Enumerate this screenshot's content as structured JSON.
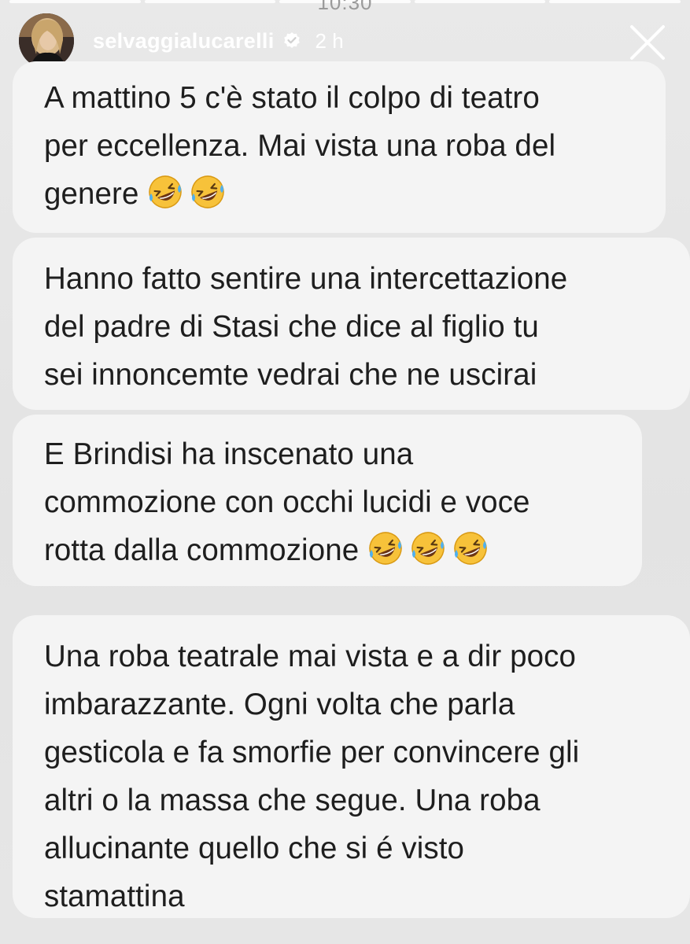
{
  "status_bar": {
    "clock": "10:30"
  },
  "story_header": {
    "username": "selvaggialucarelli",
    "time_ago": "2 h"
  },
  "messages": [
    {
      "lines": [
        "A mattino 5 c'è stato il colpo di teatro",
        "per eccellenza. Mai vista una roba del",
        "genere"
      ],
      "trailing_emoji": "rolling-on-floor-laughing-icon",
      "emoji_count": 2
    },
    {
      "lines": [
        "Hanno fatto sentire una intercettazione",
        "del padre di Stasi che dice al figlio tu",
        "sei innoncemte vedrai che ne uscirai"
      ]
    },
    {
      "lines": [
        "E Brindisi ha inscenato una",
        "commozione con occhi lucidi e voce",
        "rotta dalla commozione"
      ],
      "trailing_emoji": "rolling-on-floor-laughing-icon",
      "emoji_count": 3
    },
    {
      "lines": [
        "Una roba teatrale mai vista e a dir poco",
        "imbarazzante. Ogni volta che parla",
        "gesticola e fa smorfie per convincere gli",
        "altri o la massa che segue. Una roba",
        "allucinante quello che si é  visto",
        "stamattina"
      ]
    }
  ],
  "colors": {
    "bubble_background": "#f4f4f4",
    "page_background": "#e6e6e6",
    "text": "#1e1e1e",
    "header_text": "#ffffff",
    "verified_badge": "#ffffff"
  },
  "icons": {
    "close": "close-icon",
    "verified": "verified-badge-icon",
    "emoji": "rolling-on-floor-laughing-icon"
  }
}
